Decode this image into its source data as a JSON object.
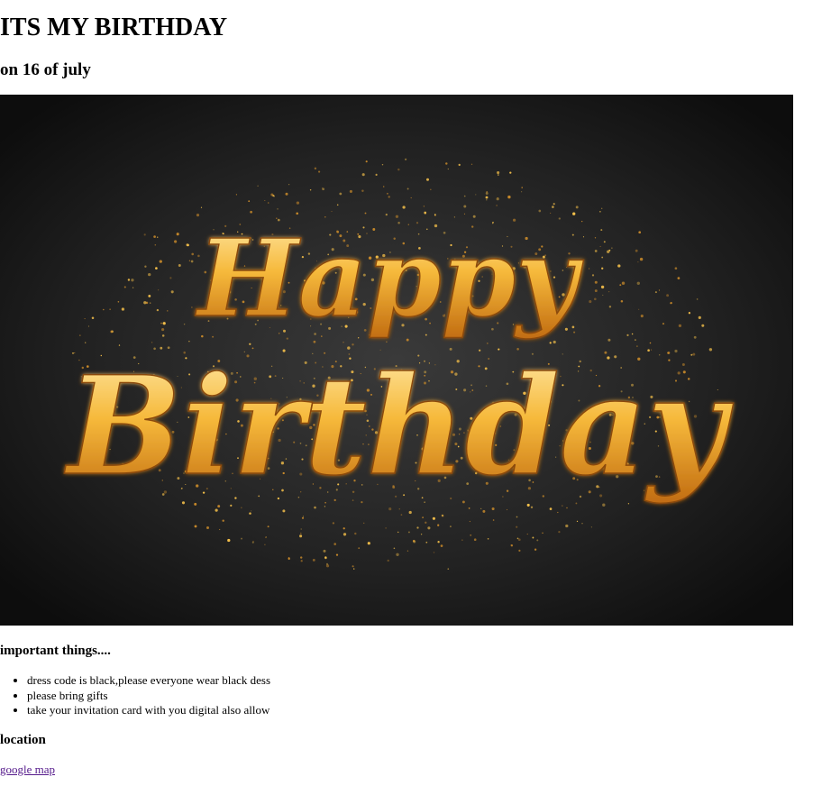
{
  "heading": "ITS MY BIRTHDAY",
  "subheading": "on 16 of july",
  "banner": {
    "line1": "Happy",
    "line2": "Birthday",
    "colors": {
      "background": "#1a1a1a",
      "gold_light": "#ffe08a",
      "gold_mid": "#f5b73a",
      "gold_dark": "#b86a12"
    }
  },
  "important": {
    "title": "important things....",
    "items": [
      "dress code is black,please everyone wear black dess",
      "please bring gifts",
      "take your invitation card with you digital also allow"
    ]
  },
  "location": {
    "title": "location",
    "link_text": "google map"
  }
}
